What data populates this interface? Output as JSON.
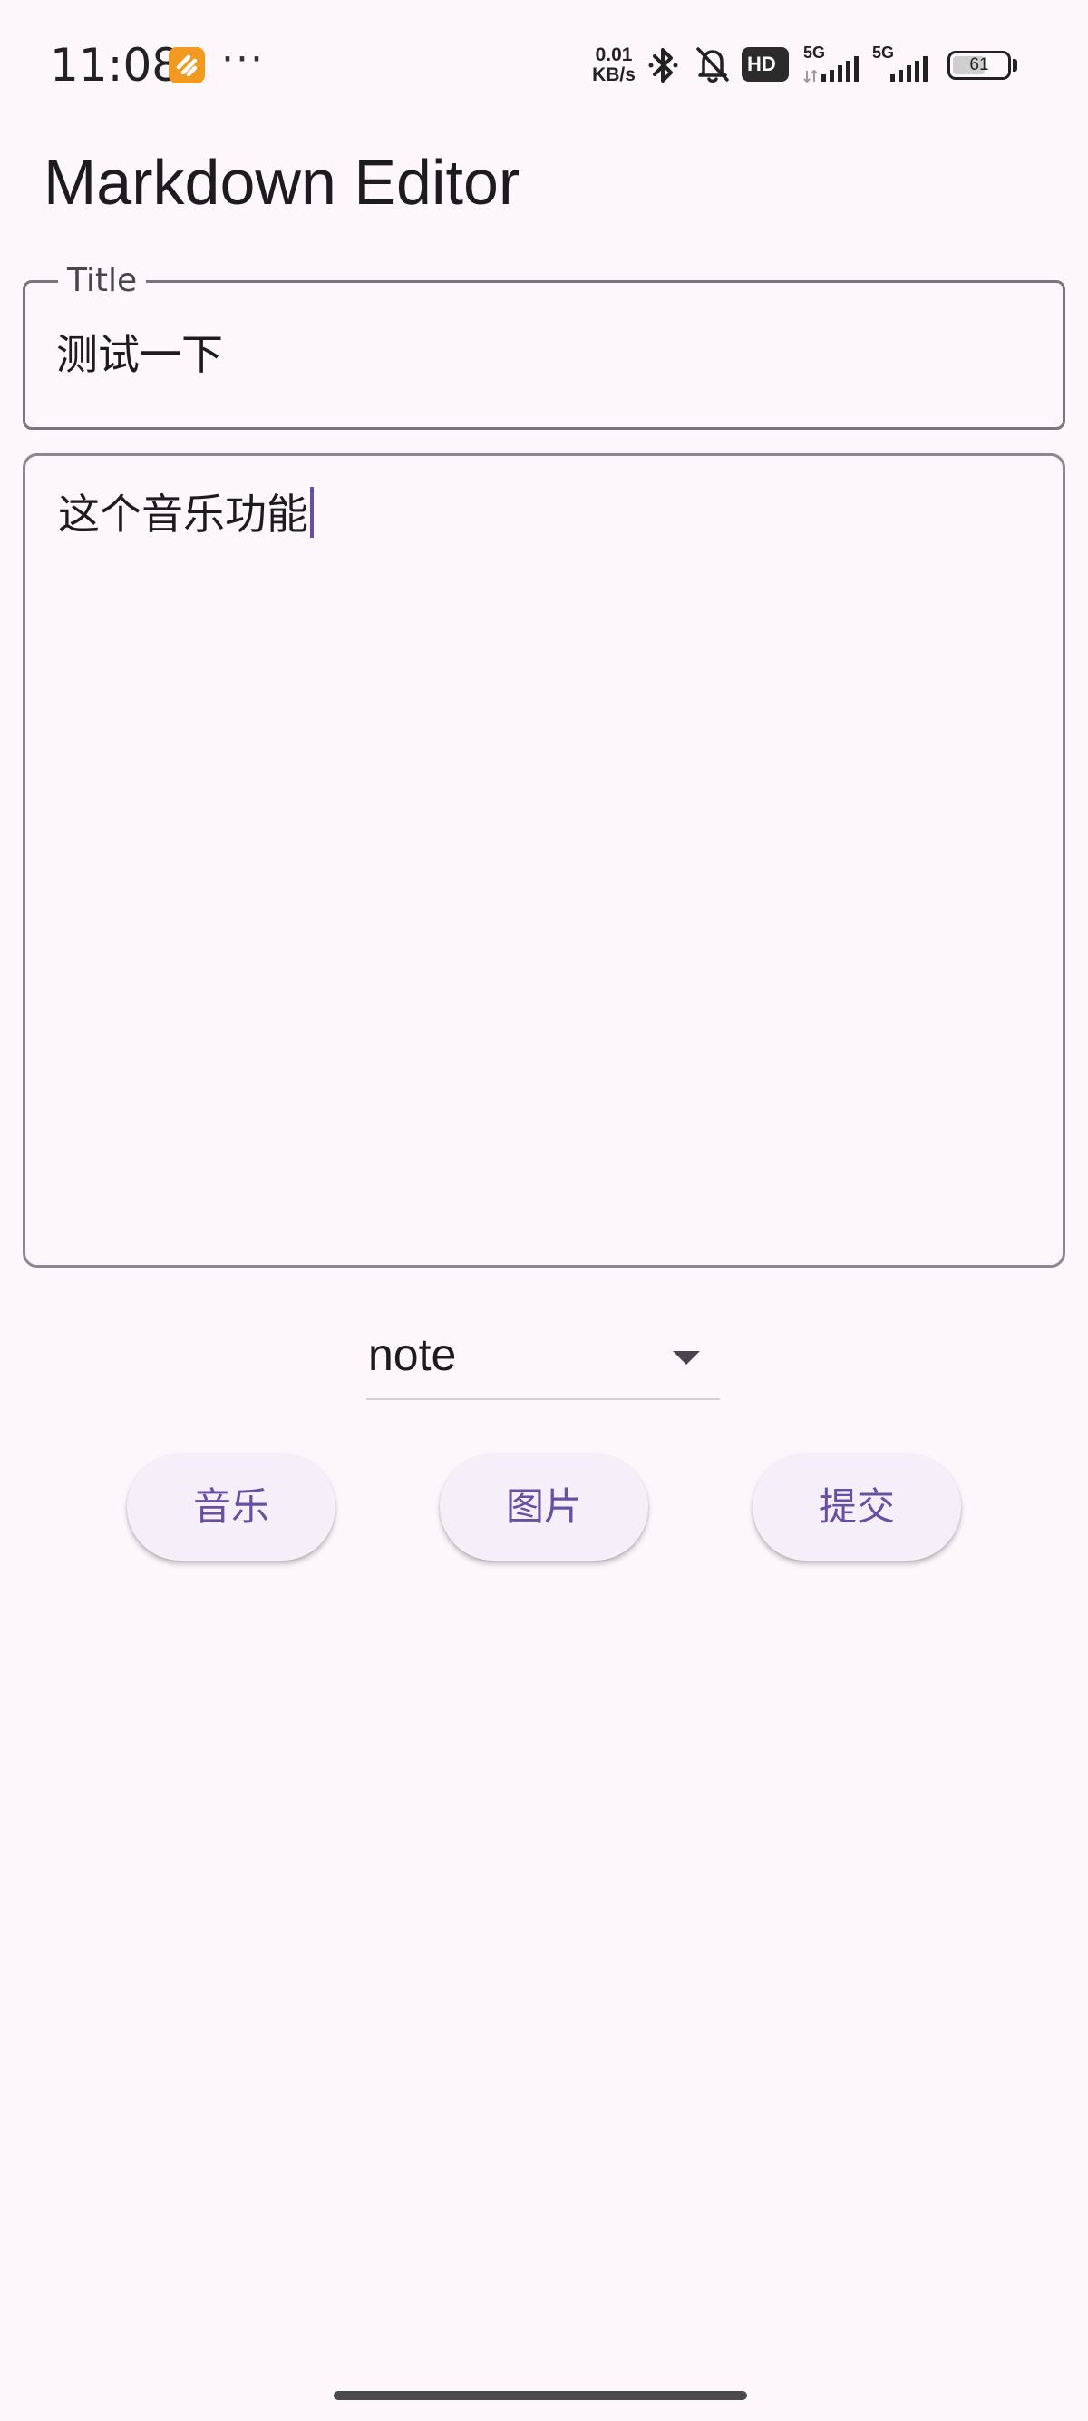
{
  "status_bar": {
    "time": "11:08",
    "more": "···",
    "net_speed_value": "0.01",
    "net_speed_unit": "KB/s",
    "hd_label": "HD",
    "sim1_label": "5G",
    "sim2_label": "5G",
    "battery_level": "61",
    "battery_fraction": 0.61,
    "icons": [
      "app-notification-icon",
      "bluetooth-icon",
      "mute-bell-icon",
      "hd-voice-icon",
      "signal-icon",
      "signal-icon",
      "battery-icon"
    ]
  },
  "app_bar": {
    "title": "Markdown Editor"
  },
  "title_field": {
    "label": "Title",
    "value": "测试一下"
  },
  "body_field": {
    "value": "这个音乐功能"
  },
  "category_dropdown": {
    "selected": "note"
  },
  "actions": {
    "music_label": "音乐",
    "image_label": "图片",
    "submit_label": "提交"
  },
  "colors": {
    "background": "#fdf7fc",
    "accent": "#6750a4",
    "outline": "#79747e",
    "button_bg": "#f5effa"
  }
}
